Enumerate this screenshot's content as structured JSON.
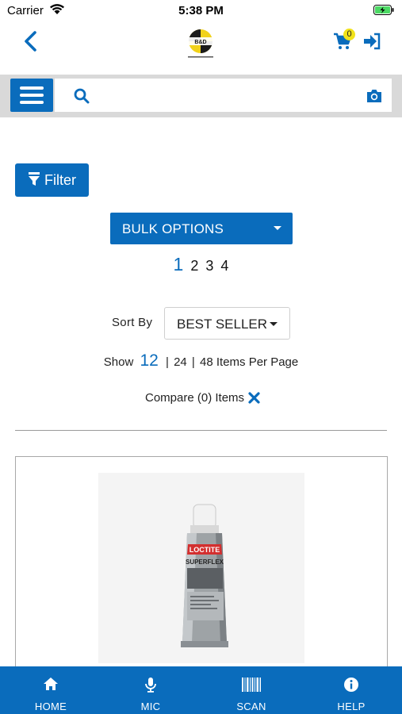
{
  "status_bar": {
    "carrier": "Carrier",
    "time": "5:38 PM"
  },
  "header": {
    "logo_text": "B&D INDUSTRIAL",
    "cart_count": "0"
  },
  "search": {
    "placeholder": "",
    "value": ""
  },
  "filter": {
    "label": "Filter"
  },
  "bulk_options": {
    "label": "BULK OPTIONS"
  },
  "pagination": {
    "current": "1",
    "pages": [
      "2",
      "3",
      "4"
    ]
  },
  "sort": {
    "label": "Sort By",
    "value": "BEST SELLER"
  },
  "per_page": {
    "prefix": "Show",
    "current": "12",
    "options": [
      "24",
      "48"
    ],
    "separator": "|",
    "suffix": "Items Per Page"
  },
  "compare": {
    "label": "Compare (0) Items"
  },
  "product": {
    "brand_text": "LOCTITE",
    "product_text": "SUPERFLEX"
  },
  "bottom_nav": [
    {
      "label": "HOME",
      "icon": "home-icon"
    },
    {
      "label": "MIC",
      "icon": "mic-icon"
    },
    {
      "label": "SCAN",
      "icon": "barcode-icon"
    },
    {
      "label": "HELP",
      "icon": "info-icon"
    }
  ],
  "colors": {
    "primary": "#0a6cbc",
    "badge": "#f1e21a",
    "search_strip": "#d9d9d9"
  }
}
